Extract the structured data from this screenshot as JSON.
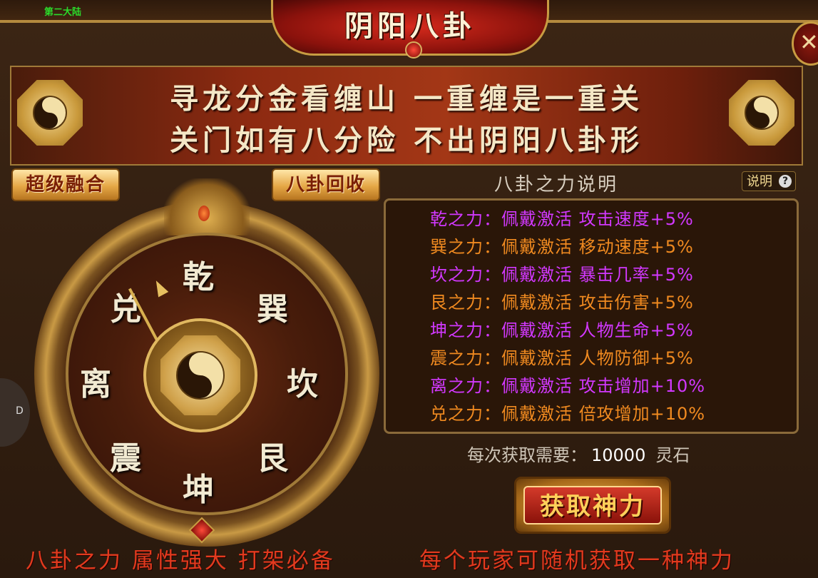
{
  "window": {
    "title": "阴阳八卦",
    "mini_tag": "第二大陆",
    "close_glyph": "✕"
  },
  "banner": {
    "line1": "寻龙分金看缠山 一重缠是一重关",
    "line2": "关门如有八分险 不出阴阳八卦形"
  },
  "buttons": {
    "super_fusion": "超级融合",
    "bagua_recycle": "八卦回收",
    "help": "说明",
    "help_q": "?",
    "obtain": "获取神力"
  },
  "wheel": {
    "trigrams": [
      "乾",
      "巽",
      "坎",
      "艮",
      "坤",
      "震",
      "离",
      "兑"
    ]
  },
  "description": {
    "title": "八卦之力说明",
    "rows": [
      {
        "text": "乾之力：佩戴激活 攻击速度+5%",
        "color": "purple"
      },
      {
        "text": "巽之力：佩戴激活 移动速度+5%",
        "color": "orange"
      },
      {
        "text": "坎之力：佩戴激活 暴击几率+5%",
        "color": "purple"
      },
      {
        "text": "艮之力：佩戴激活 攻击伤害+5%",
        "color": "orange"
      },
      {
        "text": "坤之力：佩戴激活 人物生命+5%",
        "color": "purple"
      },
      {
        "text": "震之力：佩戴激活 人物防御+5%",
        "color": "orange"
      },
      {
        "text": "离之力：佩戴激活 攻击增加+10%",
        "color": "purple"
      },
      {
        "text": "兑之力：佩戴激活 倍攻增加+10%",
        "color": "orange"
      }
    ]
  },
  "cost": {
    "label": "每次获取需要：",
    "amount": "10000",
    "unit": "灵石"
  },
  "footer": {
    "left": "八卦之力 属性强大 打架必备",
    "right": "每个玩家可随机获取一种神力"
  },
  "side_handle": {
    "label": "D"
  }
}
